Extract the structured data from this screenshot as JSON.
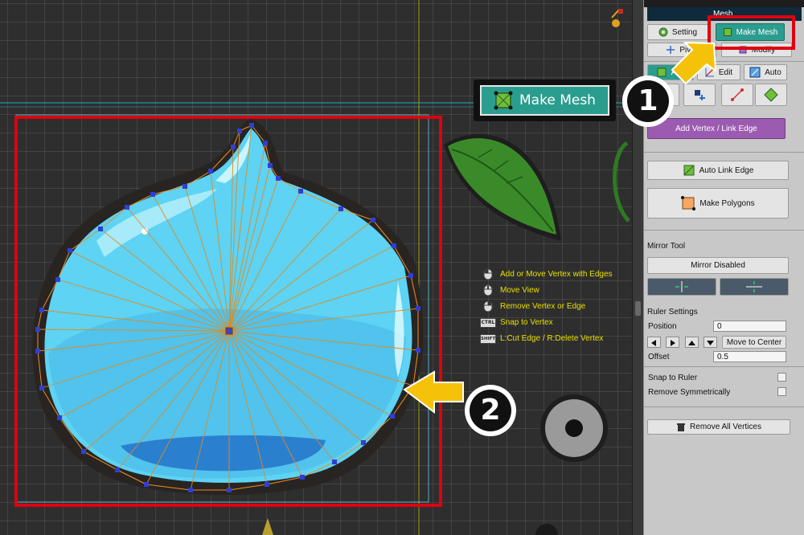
{
  "panel": {
    "title": "Mesh",
    "tabs": {
      "setting": "Setting",
      "make_mesh": "Make Mesh",
      "pivot": "Pivot",
      "modify": "Modify"
    },
    "modes": {
      "add": "Add",
      "edit": "Edit",
      "auto": "Auto"
    },
    "add_vertex_link_edge": "Add Vertex / Link Edge",
    "auto_link_edge": "Auto Link Edge",
    "make_polygons": "Make Polygons",
    "mirror_tool": "Mirror Tool",
    "mirror_disabled": "Mirror Disabled",
    "ruler_settings": "Ruler Settings",
    "position_label": "Position",
    "position_value": "0",
    "move_to_center": "Move to Center",
    "offset_label": "Offset",
    "offset_value": "0.5",
    "snap_to_ruler": "Snap to Ruler",
    "remove_symmetrically": "Remove Symmetrically",
    "remove_all_vertices": "Remove All Vertices"
  },
  "callout": {
    "make_mesh": "Make Mesh"
  },
  "markers": {
    "one": "1",
    "two": "2"
  },
  "hints": [
    {
      "icon": "mouse-left-icon",
      "text": "Add or Move Vertex with Edges"
    },
    {
      "icon": "mouse-middle-icon",
      "text": "Move View"
    },
    {
      "icon": "mouse-right-icon",
      "text": "Remove Vertex or Edge"
    },
    {
      "icon": "ctrl-key-icon",
      "key": "CTRL",
      "text": "Snap to Vertex"
    },
    {
      "icon": "shift-key-icon",
      "key": "SHIFT",
      "text": "L:Cut Edge / R:Delete Vertex"
    }
  ],
  "colors": {
    "highlight_red": "#e00010",
    "arrow_yellow": "#f5c20a",
    "teal": "#2a9d8f",
    "purple_button": "#9b5bb0",
    "hint_yellow": "#e8e000",
    "mesh_orange": "#e08a1e",
    "vertex_blue": "#2d3fd6",
    "water_blue": "#5ed3f3"
  }
}
